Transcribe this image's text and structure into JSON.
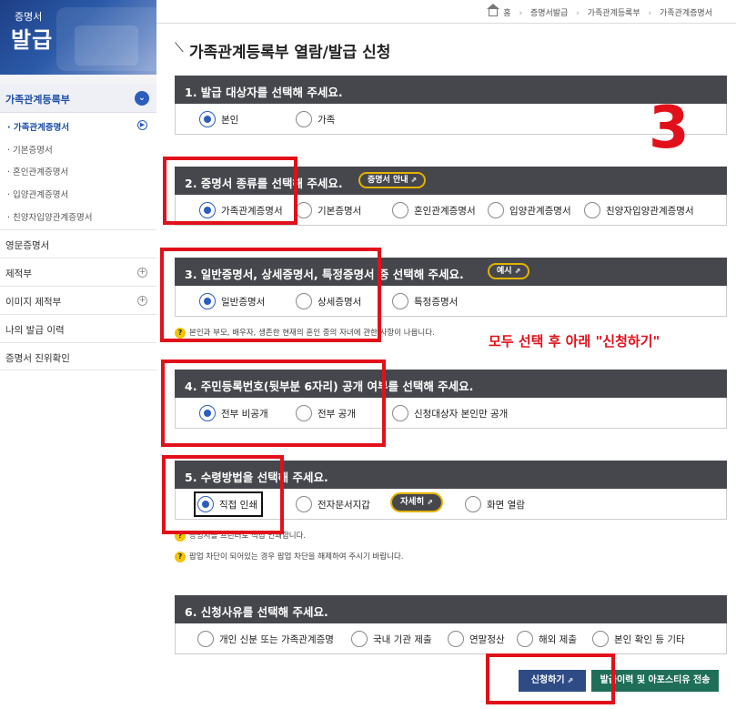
{
  "sidebar": {
    "logo_small": "증명서",
    "logo_big": "발급",
    "section_header": "가족관계등록부",
    "sub_items": [
      "· 가족관계증명서",
      "· 기본증명서",
      "· 혼인관계증명서",
      "· 입양관계증명서",
      "· 친양자입양관계증명서"
    ],
    "menus": [
      "영문증명서",
      "제적부",
      "이미지 제적부",
      "나의 발급 이력",
      "증명서 진위확인"
    ]
  },
  "breadcrumb": [
    "홈",
    "증명서발급",
    "가족관계등록부",
    "가족관계증명서"
  ],
  "page_title": "가족관계등록부 열람/발급 신청",
  "sections": {
    "s1": {
      "title": "1. 발급 대상자를 선택해 주세요.",
      "options": [
        "본인",
        "가족"
      ]
    },
    "s2": {
      "title": "2. 증명서 종류를 선택해 주세요.",
      "guide": "증명서 안내",
      "options": [
        "가족관계증명서",
        "기본증명서",
        "혼인관계증명서",
        "입양관계증명서",
        "친양자입양관계증명서"
      ]
    },
    "s3": {
      "title": "3. 일반증명서, 상세증명서, 특정증명서 중 선택해 주세요.",
      "guide": "예시",
      "options": [
        "일반증명서",
        "상세증명서",
        "특정증명서"
      ],
      "note": "본인과 부모, 배우자, 생존한 현재의 혼인 중의 자녀에 관한 사항이 나옵니다."
    },
    "s4": {
      "title": "4. 주민등록번호(뒷부분 6자리) 공개 여부를 선택해 주세요.",
      "options": [
        "전부 비공개",
        "전부 공개",
        "신청대상자 본인만 공개"
      ]
    },
    "s5": {
      "title": "5. 수령방법을 선택해 주세요.",
      "options": [
        "직접 인쇄",
        "전자문서지갑",
        "화면 열람"
      ],
      "detail_btn": "자세히",
      "note1": "증명서를 프린터로 직접 인쇄합니다.",
      "note2": "팝업 차단이 되어있는 경우 팝업 차단을 해제하여 주시기 바랍니다."
    },
    "s6": {
      "title": "6. 신청사유를 선택해 주세요.",
      "options": [
        "개인 신분 또는 가족관계증명",
        "국내 기관 제출",
        "연말정산",
        "해외 제출",
        "본인 확인 등 기타"
      ]
    }
  },
  "annotations": {
    "big_number": "3",
    "instruction": "모두 선택 후 아래 \"신청하기\""
  },
  "actions": {
    "apply": "신청하기",
    "send": "발급이력 및 아포스티유 전송"
  },
  "colors": {
    "accent": "#2b5dbe",
    "annotation_red": "#e2101a",
    "section_header": "#45474c"
  }
}
